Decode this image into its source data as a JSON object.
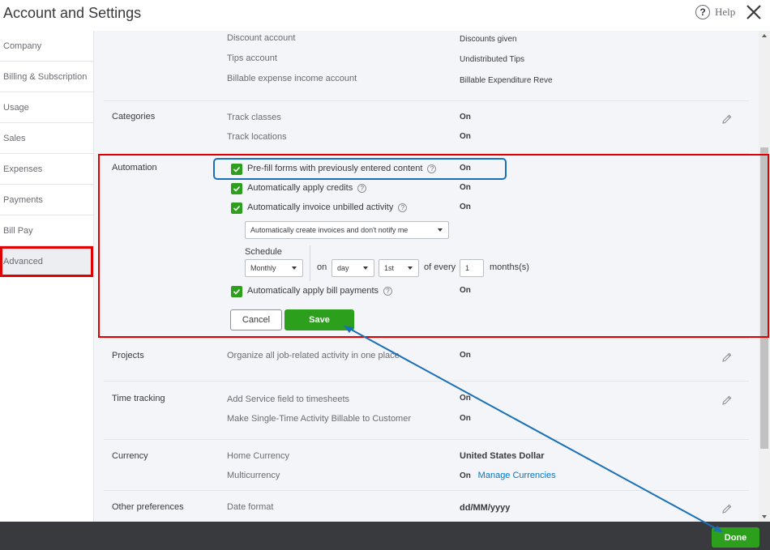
{
  "header": {
    "title": "Account and Settings",
    "help_label": "Help",
    "help_glyph": "?"
  },
  "sidebar": {
    "items": [
      {
        "label": "Company"
      },
      {
        "label": "Billing & Subscription"
      },
      {
        "label": "Usage"
      },
      {
        "label": "Sales"
      },
      {
        "label": "Expenses"
      },
      {
        "label": "Payments"
      },
      {
        "label": "Bill Pay"
      },
      {
        "label": "Advanced",
        "active": true
      }
    ]
  },
  "accounts": {
    "discount_field": "Discount account",
    "discount_value": "Discounts given",
    "tips_field": "Tips account",
    "tips_value": "Undistributed Tips",
    "billable_field": "Billable expense income account",
    "billable_value": "Billable Expenditure Reve"
  },
  "categories": {
    "label": "Categories",
    "track_classes": "Track classes",
    "track_classes_value": "On",
    "track_locations": "Track locations",
    "track_locations_value": "On"
  },
  "automation": {
    "label": "Automation",
    "prefill_label": "Pre-fill forms with previously entered content",
    "prefill_value": "On",
    "credits_label": "Automatically apply credits",
    "credits_value": "On",
    "invoice_label": "Automatically invoice unbilled activity",
    "invoice_value": "On",
    "invoice_mode": "Automatically create invoices and don't notify me",
    "schedule_label": "Schedule",
    "frequency": "Monthly",
    "on_label": "on",
    "day": "day",
    "ordinal": "1st",
    "of_every_label": "of every",
    "interval": "1",
    "months_label": "months(s)",
    "bill_payments_label": "Automatically apply bill payments",
    "bill_payments_value": "On",
    "cancel_label": "Cancel",
    "save_label": "Save"
  },
  "projects": {
    "label": "Projects",
    "field": "Organize all job-related activity in one place",
    "value": "On"
  },
  "time_tracking": {
    "label": "Time tracking",
    "service_field": "Add Service field to timesheets",
    "service_value": "On",
    "billable_field": "Make Single-Time Activity Billable to Customer",
    "billable_value": "On"
  },
  "currency": {
    "label": "Currency",
    "home_field": "Home Currency",
    "home_value": "United States Dollar",
    "multi_field": "Multicurrency",
    "multi_value": "On",
    "manage_link": "Manage Currencies"
  },
  "other": {
    "label": "Other preferences",
    "date_field": "Date format",
    "date_value": "dd/MM/yyyy"
  },
  "footer": {
    "done_label": "Done"
  },
  "colors": {
    "brand_green": "#2ca01c",
    "annotation_red": "#e00000",
    "annotation_blue": "#1a70b8",
    "footer_bg": "#393a3d",
    "link_blue": "#0077c5"
  },
  "icons": [
    "help-icon",
    "close-icon",
    "pencil-icon",
    "checkbox-checked-icon",
    "question-icon",
    "caret-down-icon"
  ]
}
